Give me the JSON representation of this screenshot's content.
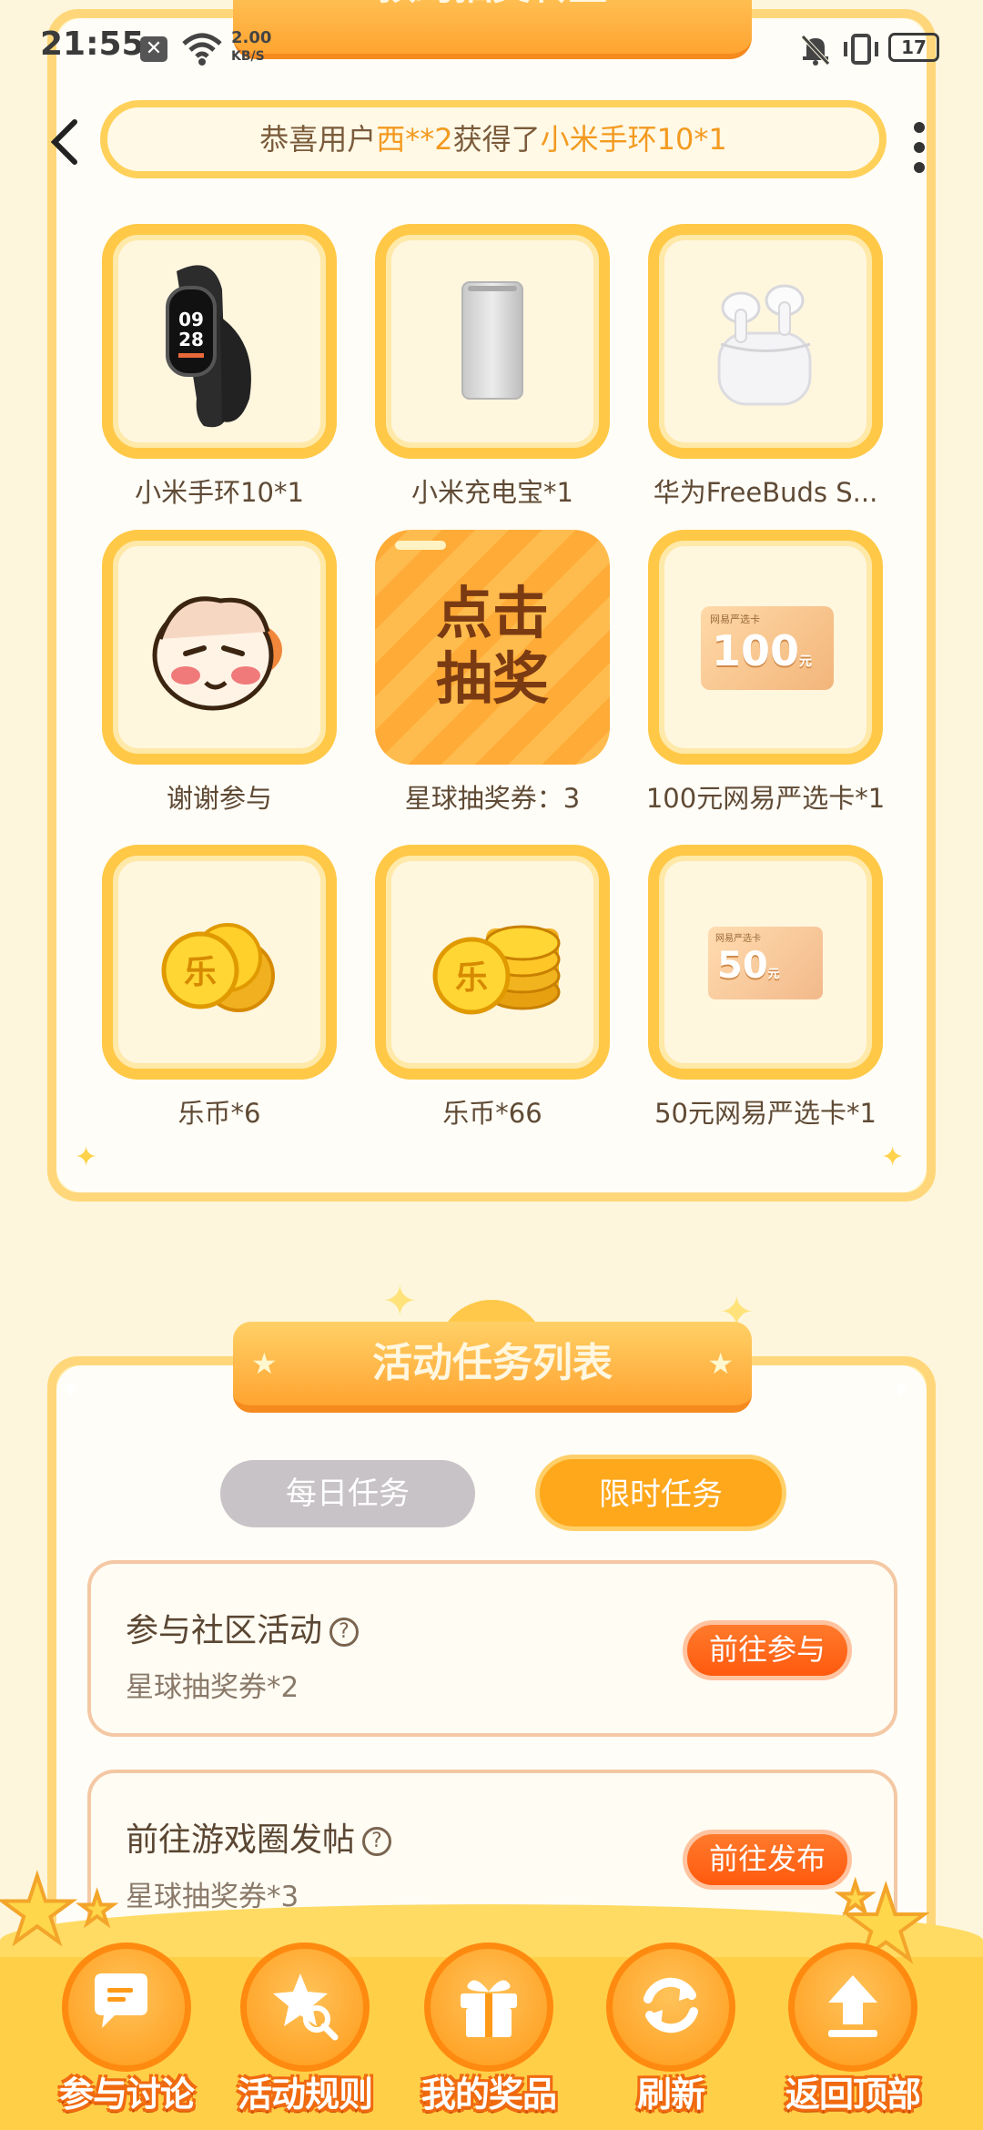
{
  "status_bar": {
    "time": "21:55",
    "speed_value": "2.00",
    "speed_unit": "KB/S",
    "battery": "17"
  },
  "lottery": {
    "title": "预约抽奖转盘",
    "banner": {
      "prefix": "恭喜用户",
      "user": "西**2",
      "middle": "获得了",
      "prize": "小米手环10*1"
    },
    "prizes": [
      {
        "label": "小米手环10*1",
        "icon": "smart-band-icon"
      },
      {
        "label": "小米充电宝*1",
        "icon": "power-bank-icon"
      },
      {
        "label": "华为FreeBuds S...",
        "icon": "earbuds-icon"
      },
      {
        "label": "谢谢参与",
        "icon": "mascot-icon"
      },
      {
        "label": "星球抽奖券：3",
        "icon": "draw-button"
      },
      {
        "label": "100元网易严选卡*1",
        "icon": "gift-card-icon",
        "card_value": "100",
        "card_unit": "元",
        "card_brand": "网易严选卡"
      },
      {
        "label": "乐币*6",
        "icon": "coins-icon",
        "coin_char": "乐"
      },
      {
        "label": "乐币*66",
        "icon": "coins-icon",
        "coin_char": "乐"
      },
      {
        "label": "50元网易严选卡*1",
        "icon": "gift-card-icon",
        "card_value": "50",
        "card_unit": "元",
        "card_brand": "网易严选卡"
      }
    ],
    "draw_button": {
      "line1": "点击",
      "line2": "抽奖"
    }
  },
  "tasks": {
    "title": "活动任务列表",
    "tabs": [
      {
        "label": "每日任务",
        "active": false
      },
      {
        "label": "限时任务",
        "active": true
      }
    ],
    "items": [
      {
        "name": "参与社区活动",
        "reward": "星球抽奖券*2",
        "button": "前往参与"
      },
      {
        "name": "前往游戏圈发帖",
        "reward": "星球抽奖券*3",
        "button": "前往发布"
      }
    ],
    "help_glyph": "?"
  },
  "bottom_nav": [
    {
      "label": "参与讨论",
      "icon": "chat-bubbles-icon"
    },
    {
      "label": "活动规则",
      "icon": "star-search-icon"
    },
    {
      "label": "我的奖品",
      "icon": "gift-box-icon"
    },
    {
      "label": "刷新",
      "icon": "refresh-icon"
    },
    {
      "label": "返回顶部",
      "icon": "back-to-top-icon"
    }
  ],
  "colors": {
    "accent_orange": "#ffa431",
    "highlight": "#f39a20",
    "button_red_orange": "#ff5a0e",
    "inactive_tab": "#c8c3c7",
    "background": "#fdf6dc"
  }
}
